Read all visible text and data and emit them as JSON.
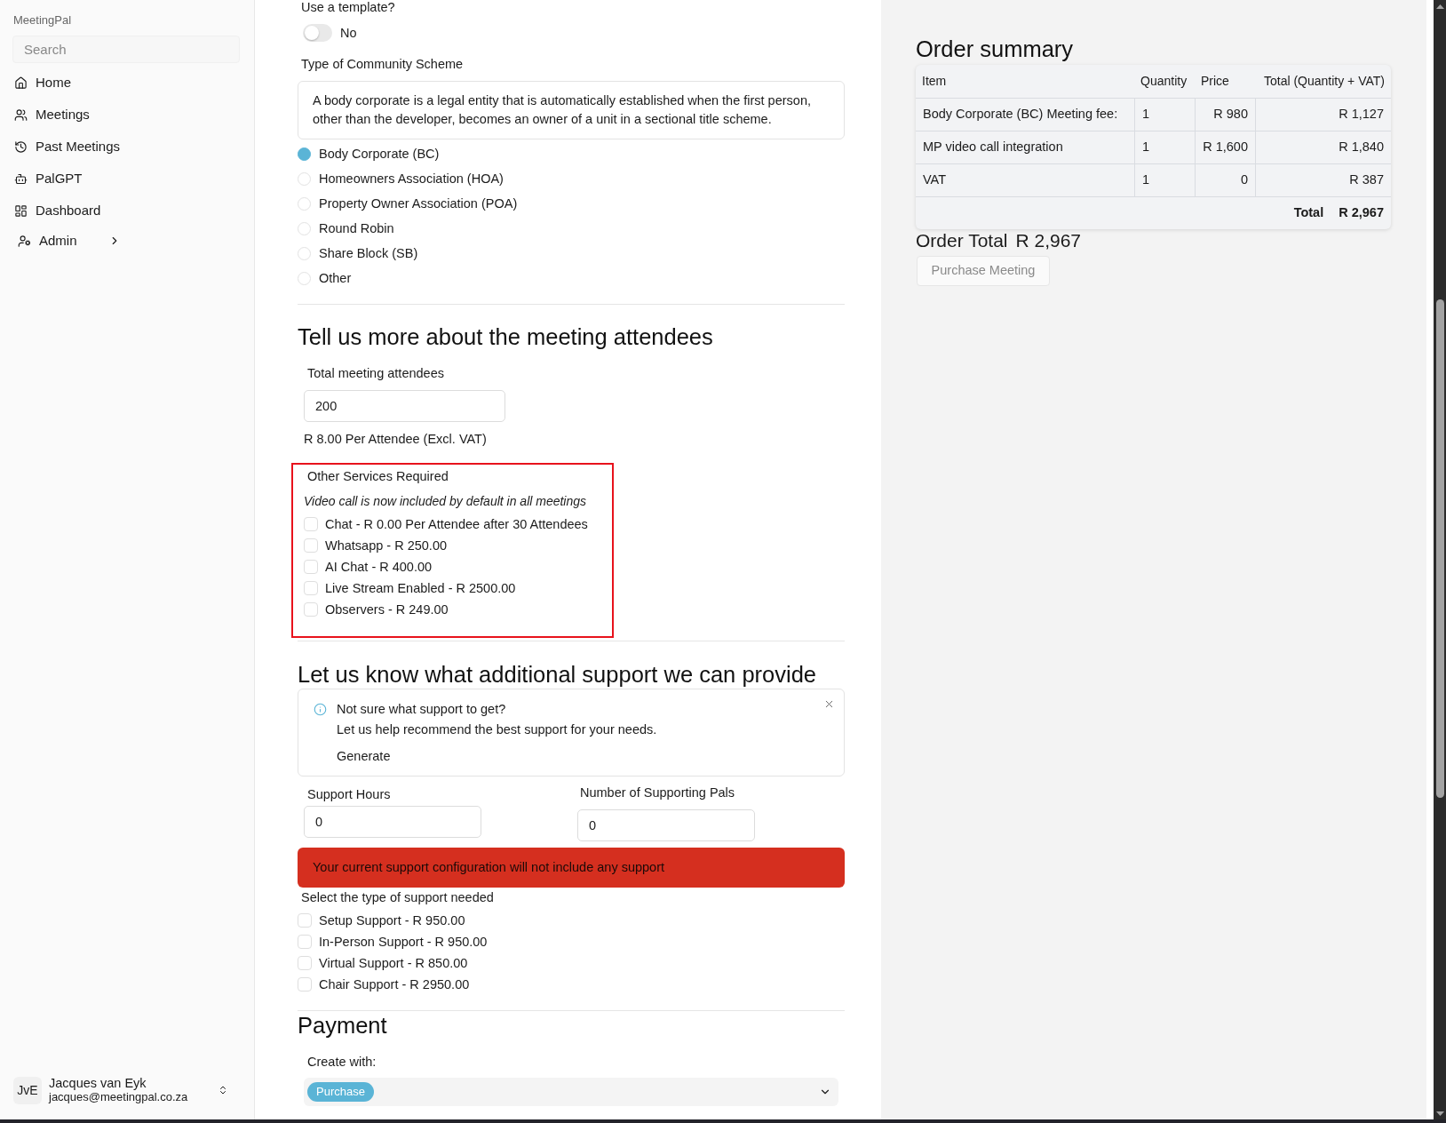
{
  "sidebar": {
    "brand": "MeetingPal",
    "search": {
      "placeholder": "Search"
    },
    "items": [
      {
        "label": "Home",
        "kind": "link",
        "selected": false
      },
      {
        "label": "Meetings",
        "kind": "link",
        "selected": false
      },
      {
        "label": "Past Meetings",
        "kind": "link",
        "selected": false
      },
      {
        "label": "PalGPT",
        "kind": "link",
        "selected": false
      },
      {
        "label": "Dashboard",
        "kind": "link",
        "selected": false
      },
      {
        "label": "Admin",
        "kind": "group",
        "selected": false
      }
    ],
    "user": {
      "initials": "JvE",
      "name": "Jacques van Eyk",
      "email": "jacques@meetingpal.co.za"
    }
  },
  "template": {
    "label": "Use a template?",
    "toggle": {
      "on": false,
      "label": "No"
    }
  },
  "scheme": {
    "label": "Type of Community Scheme",
    "description": "A body corporate is a legal entity that is automatically established when the first person, other than the developer, becomes an owner of a unit in a sectional title scheme.",
    "options": [
      {
        "label": "Body Corporate (BC)",
        "selected": true
      },
      {
        "label": "Homeowners Association (HOA)",
        "selected": false
      },
      {
        "label": "Property Owner Association (POA)",
        "selected": false
      },
      {
        "label": "Round Robin",
        "selected": false
      },
      {
        "label": "Share Block (SB)",
        "selected": false
      },
      {
        "label": "Other",
        "selected": false
      }
    ]
  },
  "attendees": {
    "heading": "Tell us more about the meeting attendees",
    "field": {
      "label": "Total meeting attendees",
      "value": "200"
    },
    "rate": "R 8.00 Per Attendee (Excl. VAT)"
  },
  "services": {
    "highlighted": true,
    "title": "Other Services Required",
    "note": "Video call is now included by default in all meetings",
    "options": [
      {
        "label": "Chat - R 0.00 Per Attendee after 30 Attendees",
        "checked": false
      },
      {
        "label": "Whatsapp - R 250.00",
        "checked": false
      },
      {
        "label": "AI Chat - R 400.00",
        "checked": false
      },
      {
        "label": "Live Stream Enabled - R 2500.00",
        "checked": false
      },
      {
        "label": "Observers - R 249.00",
        "checked": false
      }
    ]
  },
  "support": {
    "heading": "Let us know what additional support we can provide",
    "tip": {
      "title": "Not sure what support to get?",
      "text": "Let us help recommend the best support for your needs.",
      "action": "Generate"
    },
    "hours": {
      "label": "Support Hours",
      "value": "0"
    },
    "pals": {
      "label": "Number of Supporting Pals",
      "value": "0"
    },
    "warning": "Your current support configuration will not include any support",
    "types_label": "Select the type of support needed",
    "types": [
      {
        "label": "Setup Support - R 950.00",
        "checked": false
      },
      {
        "label": "In-Person Support - R 950.00",
        "checked": false
      },
      {
        "label": "Virtual Support - R 850.00",
        "checked": false
      },
      {
        "label": "Chair Support - R 2950.00",
        "checked": false
      }
    ]
  },
  "payment": {
    "heading": "Payment",
    "label": "Create with:",
    "selection": "Purchase"
  },
  "order_summary": {
    "heading": "Order summary",
    "columns": [
      "Item",
      "Quantity",
      "Price",
      "Total (Quantity + VAT)"
    ],
    "rows": [
      [
        "Body Corporate (BC) Meeting fee:",
        "1",
        "R 980",
        "R 1,127"
      ],
      [
        "MP video call integration",
        "1",
        "R 1,600",
        "R 1,840"
      ],
      [
        "VAT",
        "1",
        "0",
        "R 387"
      ]
    ],
    "total": {
      "label": "Total",
      "value": "R 2,967"
    },
    "order_total": {
      "label": "Order Total",
      "value": "R 2,967"
    },
    "button": {
      "label": "Purchase Meeting",
      "disabled": true
    }
  }
}
